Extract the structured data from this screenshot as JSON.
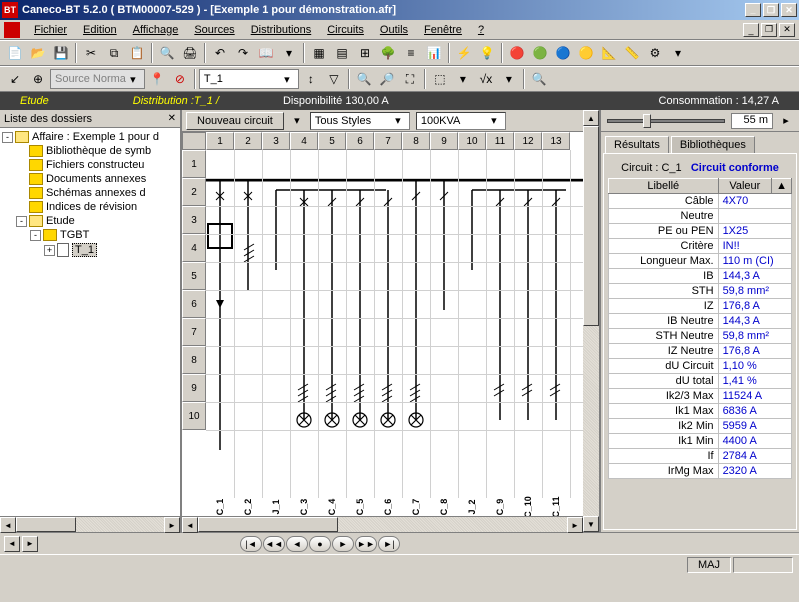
{
  "title": "Caneco-BT 5.2.0 ( BTM00007-529 ) - [Exemple 1 pour démonstration.afr]",
  "menus": [
    "Fichier",
    "Edition",
    "Affichage",
    "Sources",
    "Distributions",
    "Circuits",
    "Outils",
    "Fenêtre",
    "?"
  ],
  "toolbar2": {
    "combo1": "Source Norma",
    "combo2": "T_1"
  },
  "darkbar": {
    "etude": "Etude",
    "dist": "Distribution :T_1 /",
    "dispo": "Disponibilité 130,00 A",
    "conso": "Consommation : 14,27 A"
  },
  "left": {
    "header": "Liste des dossiers",
    "items": [
      {
        "label": "Affaire : Exemple 1 pour d",
        "type": "folder-open",
        "toggle": "-",
        "indent": 0
      },
      {
        "label": "Bibliothèque de symb",
        "type": "folder",
        "indent": 1
      },
      {
        "label": "Fichiers constructeu",
        "type": "folder",
        "indent": 1
      },
      {
        "label": "Documents annexes",
        "type": "folder",
        "indent": 1
      },
      {
        "label": "Schémas annexes d",
        "type": "folder",
        "indent": 1
      },
      {
        "label": "Indices de révision",
        "type": "folder",
        "indent": 1
      },
      {
        "label": "Etude",
        "type": "folder-open",
        "toggle": "-",
        "indent": 1
      },
      {
        "label": "TGBT",
        "type": "folder",
        "toggle": "-",
        "indent": 2
      },
      {
        "label": "T_1",
        "type": "doc",
        "toggle": "+",
        "indent": 3,
        "selected": true
      }
    ]
  },
  "center": {
    "nouveau": "Nouveau circuit",
    "styles": "Tous Styles",
    "kva": "100KVA",
    "dist": "55 m",
    "cols": [
      "1",
      "2",
      "3",
      "4",
      "5",
      "6",
      "7",
      "8",
      "9",
      "10",
      "11",
      "12",
      "13"
    ],
    "rows": [
      "1",
      "2",
      "3",
      "4",
      "5",
      "6",
      "7",
      "8",
      "9",
      "10"
    ],
    "col_labels": [
      "C_1",
      "C_2",
      "J_1",
      "C_3",
      "C_4",
      "C_5",
      "C_6",
      "C_7",
      "C_8",
      "J_2",
      "C_9",
      "C_10",
      "C_11"
    ]
  },
  "side": {
    "slider_val": "55 m",
    "tabs": [
      "Résultats",
      "Bibliothèques"
    ],
    "circuit_label": "Circuit : C_1",
    "conforme": "Circuit conforme",
    "headers": [
      "Libellé",
      "Valeur"
    ],
    "rows": [
      {
        "l": "Câble",
        "v": "4X70"
      },
      {
        "l": "Neutre",
        "v": ""
      },
      {
        "l": "PE ou PEN",
        "v": "1X25"
      },
      {
        "l": "Critère",
        "v": "IN!!"
      },
      {
        "l": "Longueur Max.",
        "v": "110 m (CI)"
      },
      {
        "l": "IB",
        "v": "144,3 A"
      },
      {
        "l": "STH",
        "v": "59,8 mm²"
      },
      {
        "l": "IZ",
        "v": "176,8 A"
      },
      {
        "l": "IB Neutre",
        "v": "144,3 A"
      },
      {
        "l": "STH Neutre",
        "v": "59,8 mm²"
      },
      {
        "l": "IZ Neutre",
        "v": "176,8 A"
      },
      {
        "l": "dU Circuit",
        "v": "1,10 %"
      },
      {
        "l": "dU total",
        "v": "1,41 %"
      },
      {
        "l": "Ik2/3 Max",
        "v": "11524 A"
      },
      {
        "l": "Ik1 Max",
        "v": "6836 A"
      },
      {
        "l": "Ik2 Min",
        "v": "5959 A"
      },
      {
        "l": "Ik1 Min",
        "v": "4400 A"
      },
      {
        "l": "If",
        "v": "2784 A"
      },
      {
        "l": "IrMg Max",
        "v": "2320 A"
      }
    ]
  },
  "status": {
    "maj": "MAJ"
  }
}
